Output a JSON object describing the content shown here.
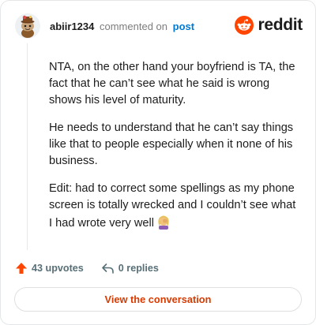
{
  "comment": {
    "username": "abiir1234",
    "action_text": "commented on",
    "post_link": "post",
    "brand": "reddit",
    "paragraphs": [
      "NTA, on the other hand your boyfriend is TA, the fact that he can’t see what he said is wrong shows his level of maturity.",
      "He needs to understand that he can’t say things like that to people especially when it none of his business.",
      "Edit: had to correct some spellings as my phone screen is totally wrecked and I couldn’t see what I had wrote very well"
    ],
    "emoji_icon": "woman-facepalming-emoji"
  },
  "actions": {
    "upvotes": "43 upvotes",
    "replies": "0 replies"
  },
  "cta": {
    "label": "View the conversation"
  },
  "colors": {
    "accent": "#d93a00",
    "upvote": "#ff4500",
    "link": "#0079d3"
  }
}
